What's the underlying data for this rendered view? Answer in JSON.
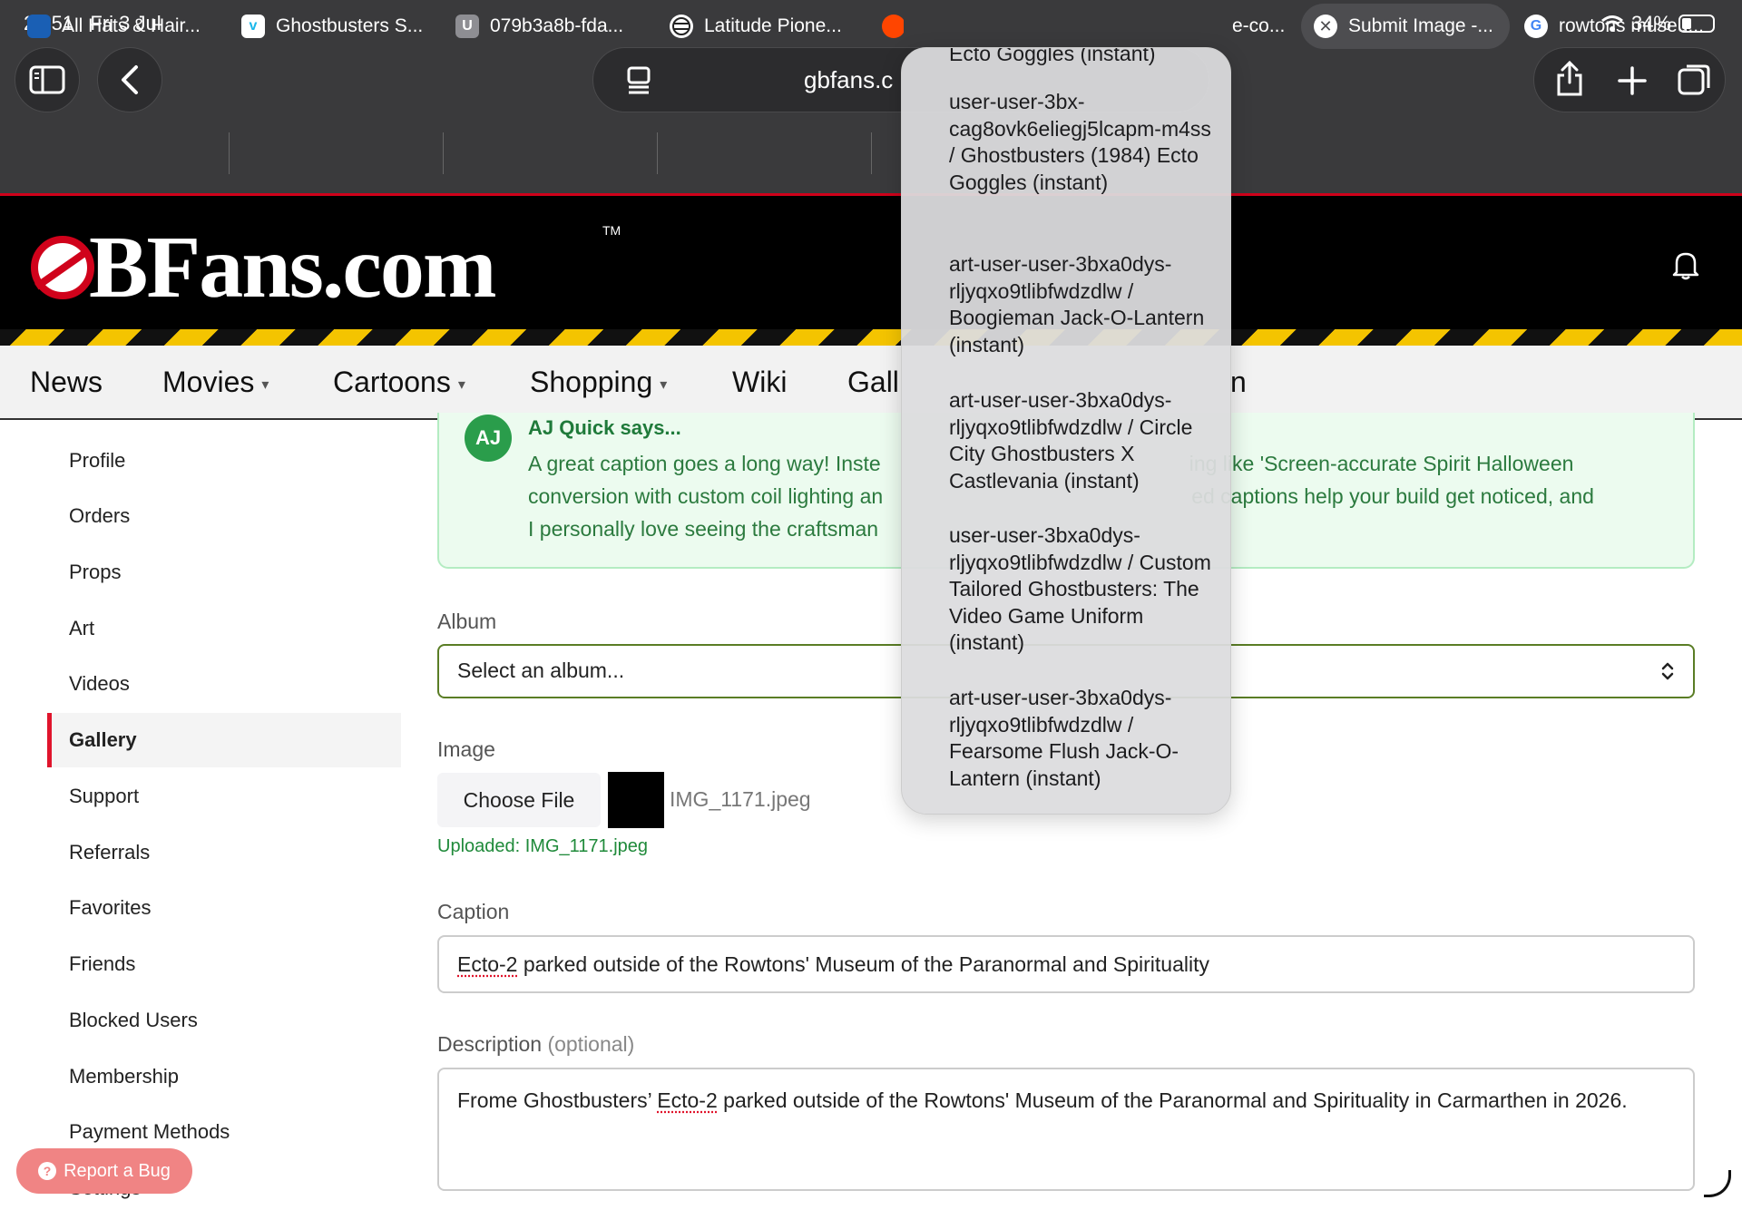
{
  "status_bar": {
    "time": "20:51",
    "date": "Fri 3 Jul",
    "battery": "34%"
  },
  "browser": {
    "address": "gbfans.c",
    "tabs": [
      {
        "label": "All Hats & Hair..."
      },
      {
        "label": "Ghostbusters S..."
      },
      {
        "label": "079b3a8b-fda..."
      },
      {
        "label": "Latitude Pione..."
      },
      {
        "label": "e-co..."
      },
      {
        "label": "Submit Image -..."
      },
      {
        "label": "rowtons museu..."
      }
    ],
    "favicon_letters": {
      "vimeo": "v",
      "u": "U",
      "google": "G"
    }
  },
  "site": {
    "logo_text": "BFans.com",
    "logo_tm": "TM"
  },
  "nav": {
    "items": [
      "News",
      "Movies",
      "Cartoons",
      "Shopping",
      "Wiki",
      "Gall",
      "n"
    ],
    "caret": "▾"
  },
  "sidebar": {
    "items": [
      "Profile",
      "Orders",
      "Props",
      "Art",
      "Videos",
      "Gallery",
      "Support",
      "Referrals",
      "Favorites",
      "Friends",
      "Blocked Users",
      "Membership",
      "Payment Methods",
      "Settings"
    ]
  },
  "aj": {
    "avatar": "AJ",
    "title": "AJ Quick says...",
    "line1a": "A great caption goes a long way! Inste",
    "line1b": "ing like 'Screen-accurate Spirit Halloween",
    "line2a": "conversion with custom coil lighting an",
    "line2b": "ed captions help your build get noticed, and",
    "line3a": "I personally love seeing the craftsman"
  },
  "form": {
    "album_label": "Album",
    "album_value": "Select an album...",
    "image_label": "Image",
    "choose_file": "Choose File",
    "file_name": "IMG_1171.jpeg",
    "uploaded": "Uploaded: IMG_1171.jpeg",
    "caption_label": "Caption",
    "caption_a": "Ecto-2",
    "caption_b": " parked outside of the Rowtons' Museum of the Paranormal and Spirituality",
    "description_label": "Description",
    "description_optional": "(optional)",
    "description_a": "Frome Ghostbusters’ ",
    "description_b": "Ecto-2",
    "description_c": " parked outside of the Rowtons' Museum of the Paranormal and Spirituality in Carmarthen in 2026."
  },
  "dropdown": {
    "items": [
      "Ecto Goggles (instant)",
      "user-user-3bx-cag8ovk6eliegj5lcapm-m4ss / Ghostbusters (1984) Ecto Goggles (instant)",
      "art-user-user-3bxa0dys-rljyqxo9tlibfwdzdlw / Boogieman Jack-O-Lantern (instant)",
      "art-user-user-3bxa0dys-rljyqxo9tlibfwdzdlw / Circle City Ghostbusters X Castlevania (instant)",
      "user-user-3bxa0dys-rljyqxo9tlibfwdzdlw / Custom Tailored Ghostbusters: The Video Game Uniform (instant)",
      "art-user-user-3bxa0dys-rljyqxo9tlibfwdzdlw / Fearsome Flush Jack-O-Lantern (instant)"
    ]
  },
  "report_bug": "Report a Bug",
  "report_bug_icon": "?",
  "colors": {
    "accent_red": "#d0021b",
    "hazard_yellow": "#f4c400",
    "success_green": "#1f8a3a",
    "focus_green": "#5a7d25"
  }
}
